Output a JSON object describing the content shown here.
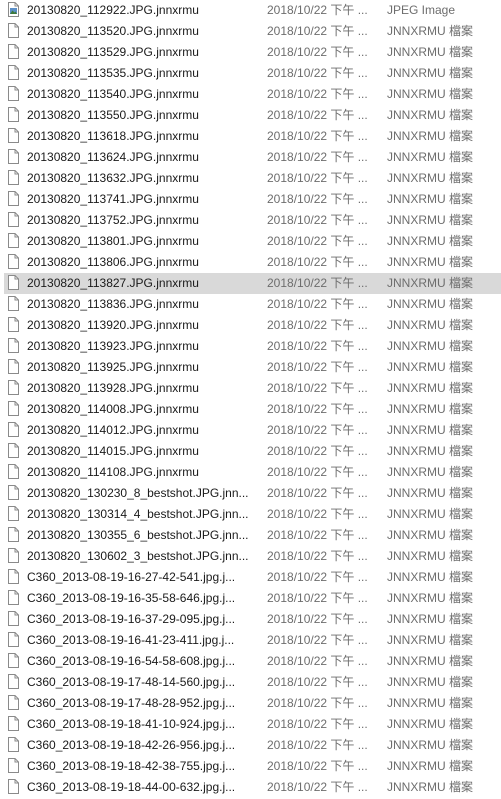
{
  "file_list": {
    "selected_index": 13,
    "rows": [
      {
        "name": "20130820_112922.JPG.jnnxrmu",
        "date": "2018/10/22 下午 ...",
        "type": "JPEG Image",
        "icon": "image-file-icon"
      },
      {
        "name": "20130820_113520.JPG.jnnxrmu",
        "date": "2018/10/22 下午 ...",
        "type": "JNNXRMU 檔案",
        "icon": "blank-file-icon"
      },
      {
        "name": "20130820_113529.JPG.jnnxrmu",
        "date": "2018/10/22 下午 ...",
        "type": "JNNXRMU 檔案",
        "icon": "blank-file-icon"
      },
      {
        "name": "20130820_113535.JPG.jnnxrmu",
        "date": "2018/10/22 下午 ...",
        "type": "JNNXRMU 檔案",
        "icon": "blank-file-icon"
      },
      {
        "name": "20130820_113540.JPG.jnnxrmu",
        "date": "2018/10/22 下午 ...",
        "type": "JNNXRMU 檔案",
        "icon": "blank-file-icon"
      },
      {
        "name": "20130820_113550.JPG.jnnxrmu",
        "date": "2018/10/22 下午 ...",
        "type": "JNNXRMU 檔案",
        "icon": "blank-file-icon"
      },
      {
        "name": "20130820_113618.JPG.jnnxrmu",
        "date": "2018/10/22 下午 ...",
        "type": "JNNXRMU 檔案",
        "icon": "blank-file-icon"
      },
      {
        "name": "20130820_113624.JPG.jnnxrmu",
        "date": "2018/10/22 下午 ...",
        "type": "JNNXRMU 檔案",
        "icon": "blank-file-icon"
      },
      {
        "name": "20130820_113632.JPG.jnnxrmu",
        "date": "2018/10/22 下午 ...",
        "type": "JNNXRMU 檔案",
        "icon": "blank-file-icon"
      },
      {
        "name": "20130820_113741.JPG.jnnxrmu",
        "date": "2018/10/22 下午 ...",
        "type": "JNNXRMU 檔案",
        "icon": "blank-file-icon"
      },
      {
        "name": "20130820_113752.JPG.jnnxrmu",
        "date": "2018/10/22 下午 ...",
        "type": "JNNXRMU 檔案",
        "icon": "blank-file-icon"
      },
      {
        "name": "20130820_113801.JPG.jnnxrmu",
        "date": "2018/10/22 下午 ...",
        "type": "JNNXRMU 檔案",
        "icon": "blank-file-icon"
      },
      {
        "name": "20130820_113806.JPG.jnnxrmu",
        "date": "2018/10/22 下午 ...",
        "type": "JNNXRMU 檔案",
        "icon": "blank-file-icon"
      },
      {
        "name": "20130820_113827.JPG.jnnxrmu",
        "date": "2018/10/22 下午 ...",
        "type": "JNNXRMU 檔案",
        "icon": "blank-file-icon"
      },
      {
        "name": "20130820_113836.JPG.jnnxrmu",
        "date": "2018/10/22 下午 ...",
        "type": "JNNXRMU 檔案",
        "icon": "blank-file-icon"
      },
      {
        "name": "20130820_113920.JPG.jnnxrmu",
        "date": "2018/10/22 下午 ...",
        "type": "JNNXRMU 檔案",
        "icon": "blank-file-icon"
      },
      {
        "name": "20130820_113923.JPG.jnnxrmu",
        "date": "2018/10/22 下午 ...",
        "type": "JNNXRMU 檔案",
        "icon": "blank-file-icon"
      },
      {
        "name": "20130820_113925.JPG.jnnxrmu",
        "date": "2018/10/22 下午 ...",
        "type": "JNNXRMU 檔案",
        "icon": "blank-file-icon"
      },
      {
        "name": "20130820_113928.JPG.jnnxrmu",
        "date": "2018/10/22 下午 ...",
        "type": "JNNXRMU 檔案",
        "icon": "blank-file-icon"
      },
      {
        "name": "20130820_114008.JPG.jnnxrmu",
        "date": "2018/10/22 下午 ...",
        "type": "JNNXRMU 檔案",
        "icon": "blank-file-icon"
      },
      {
        "name": "20130820_114012.JPG.jnnxrmu",
        "date": "2018/10/22 下午 ...",
        "type": "JNNXRMU 檔案",
        "icon": "blank-file-icon"
      },
      {
        "name": "20130820_114015.JPG.jnnxrmu",
        "date": "2018/10/22 下午 ...",
        "type": "JNNXRMU 檔案",
        "icon": "blank-file-icon"
      },
      {
        "name": "20130820_114108.JPG.jnnxrmu",
        "date": "2018/10/22 下午 ...",
        "type": "JNNXRMU 檔案",
        "icon": "blank-file-icon"
      },
      {
        "name": "20130820_130230_8_bestshot.JPG.jnn...",
        "date": "2018/10/22 下午 ...",
        "type": "JNNXRMU 檔案",
        "icon": "blank-file-icon"
      },
      {
        "name": "20130820_130314_4_bestshot.JPG.jnn...",
        "date": "2018/10/22 下午 ...",
        "type": "JNNXRMU 檔案",
        "icon": "blank-file-icon"
      },
      {
        "name": "20130820_130355_6_bestshot.JPG.jnn...",
        "date": "2018/10/22 下午 ...",
        "type": "JNNXRMU 檔案",
        "icon": "blank-file-icon"
      },
      {
        "name": "20130820_130602_3_bestshot.JPG.jnn...",
        "date": "2018/10/22 下午 ...",
        "type": "JNNXRMU 檔案",
        "icon": "blank-file-icon"
      },
      {
        "name": "C360_2013-08-19-16-27-42-541.jpg.j...",
        "date": "2018/10/22 下午 ...",
        "type": "JNNXRMU 檔案",
        "icon": "blank-file-icon"
      },
      {
        "name": "C360_2013-08-19-16-35-58-646.jpg.j...",
        "date": "2018/10/22 下午 ...",
        "type": "JNNXRMU 檔案",
        "icon": "blank-file-icon"
      },
      {
        "name": "C360_2013-08-19-16-37-29-095.jpg.j...",
        "date": "2018/10/22 下午 ...",
        "type": "JNNXRMU 檔案",
        "icon": "blank-file-icon"
      },
      {
        "name": "C360_2013-08-19-16-41-23-411.jpg.j...",
        "date": "2018/10/22 下午 ...",
        "type": "JNNXRMU 檔案",
        "icon": "blank-file-icon"
      },
      {
        "name": "C360_2013-08-19-16-54-58-608.jpg.j...",
        "date": "2018/10/22 下午 ...",
        "type": "JNNXRMU 檔案",
        "icon": "blank-file-icon"
      },
      {
        "name": "C360_2013-08-19-17-48-14-560.jpg.j...",
        "date": "2018/10/22 下午 ...",
        "type": "JNNXRMU 檔案",
        "icon": "blank-file-icon"
      },
      {
        "name": "C360_2013-08-19-17-48-28-952.jpg.j...",
        "date": "2018/10/22 下午 ...",
        "type": "JNNXRMU 檔案",
        "icon": "blank-file-icon"
      },
      {
        "name": "C360_2013-08-19-18-41-10-924.jpg.j...",
        "date": "2018/10/22 下午 ...",
        "type": "JNNXRMU 檔案",
        "icon": "blank-file-icon"
      },
      {
        "name": "C360_2013-08-19-18-42-26-956.jpg.j...",
        "date": "2018/10/22 下午 ...",
        "type": "JNNXRMU 檔案",
        "icon": "blank-file-icon"
      },
      {
        "name": "C360_2013-08-19-18-42-38-755.jpg.j...",
        "date": "2018/10/22 下午 ...",
        "type": "JNNXRMU 檔案",
        "icon": "blank-file-icon"
      },
      {
        "name": "C360_2013-08-19-18-44-00-632.jpg.j...",
        "date": "2018/10/22 下午 ...",
        "type": "JNNXRMU 檔案",
        "icon": "blank-file-icon"
      }
    ]
  }
}
